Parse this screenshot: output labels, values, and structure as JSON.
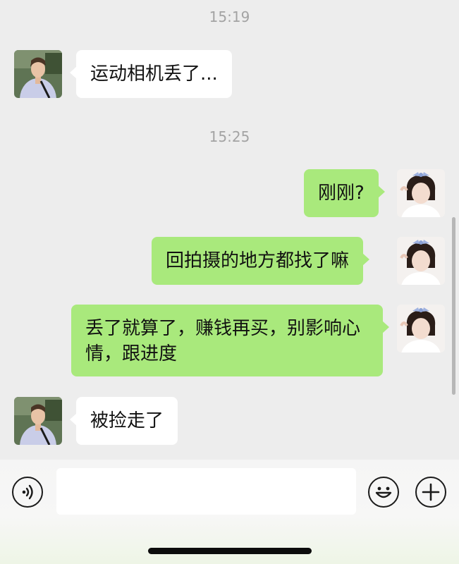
{
  "timestamps": [
    "15:19",
    "15:25"
  ],
  "messages": [
    {
      "side": "left",
      "text": "运动相机丢了..."
    },
    {
      "side": "right",
      "text": "刚刚?"
    },
    {
      "side": "right",
      "text": "回拍摄的地方都找了嘛"
    },
    {
      "side": "right",
      "text": "丢了就算了，赚钱再买，别影响心情，跟进度"
    },
    {
      "side": "left",
      "text": "被捡走了"
    }
  ],
  "avatars": {
    "left_contact": "avatar-boy-outdoor",
    "right_self": "avatar-girl-bow"
  },
  "input_bar": {
    "voice_icon": "voice-icon",
    "input_placeholder": "",
    "emoji_icon": "emoji-icon",
    "plus_icon": "plus-icon"
  },
  "colors": {
    "background": "#ededed",
    "bubble_self": "#a9e97c",
    "bubble_other": "#ffffff",
    "timestamp": "#a3a3a3"
  }
}
